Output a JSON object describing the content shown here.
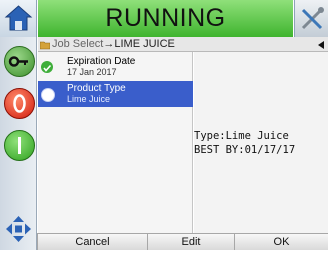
{
  "header": {
    "status": "RUNNING",
    "home_icon": "home-icon",
    "tools_icon": "tools-icon"
  },
  "breadcrumb": {
    "parent": "Job Select",
    "arrow": "→",
    "current": "LIME JUICE"
  },
  "list": {
    "items": [
      {
        "label": "Expiration Date",
        "value": "17 Jan 2017",
        "icon": "check-icon",
        "selected": false
      },
      {
        "label": "Product Type",
        "value": "Lime Juice",
        "icon": "radio-icon",
        "selected": true
      }
    ]
  },
  "preview": {
    "line1": "Type:Lime Juice",
    "line2": "BEST BY:01/17/17"
  },
  "footer": {
    "cancel": "Cancel",
    "edit": "Edit",
    "ok": "OK"
  },
  "colors": {
    "status_green": "#3fb42e",
    "selection_blue": "#3a5ecb",
    "stop_red": "#d11b0d"
  }
}
